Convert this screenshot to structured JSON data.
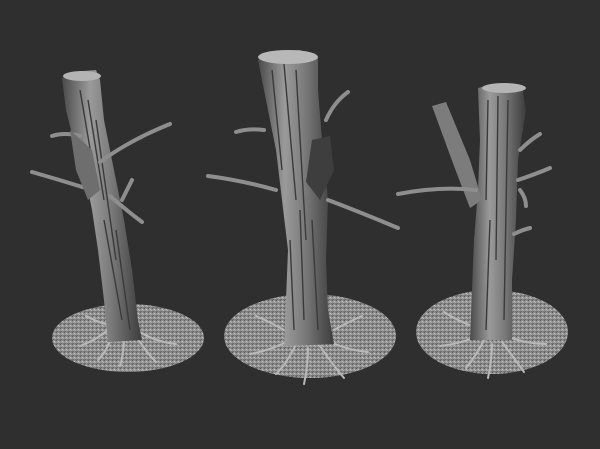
{
  "scene": {
    "background_color": "#2f2f30",
    "surface_color": "#8e8e8e",
    "shadow_color": "#3a3a3a",
    "highlight_color": "#c4c4c4",
    "trees": [
      {
        "label": "tree-stump-left",
        "branches": 6
      },
      {
        "label": "tree-stump-center",
        "branches": 5
      },
      {
        "label": "tree-stump-right",
        "branches": 6
      }
    ]
  }
}
